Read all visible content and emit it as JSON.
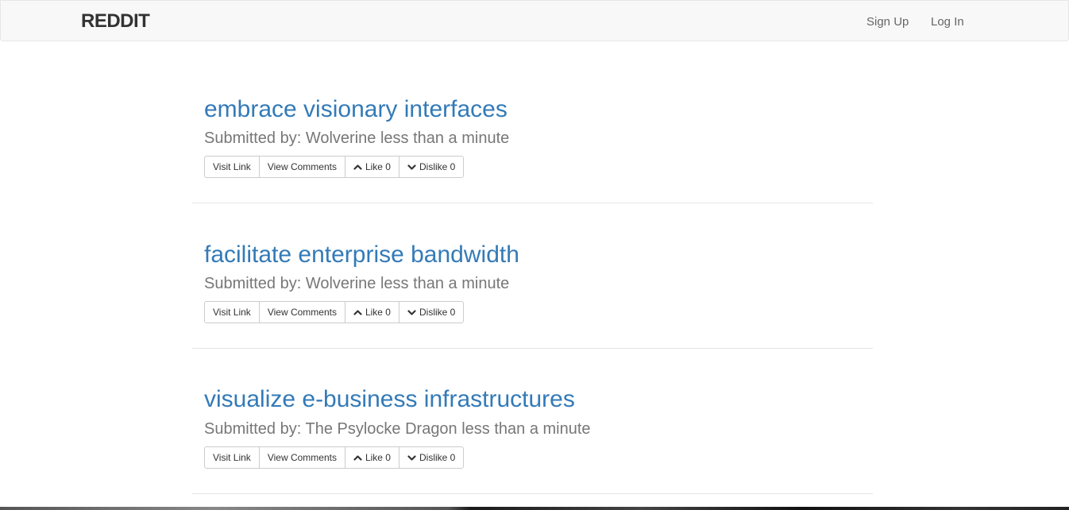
{
  "navbar": {
    "brand": "REDDIT",
    "links": [
      "Sign Up",
      "Log In"
    ]
  },
  "posts": [
    {
      "title": "embrace visionary interfaces",
      "meta": "Submitted by: Wolverine less than a minute",
      "buttons": {
        "visit": "Visit Link",
        "comments": "View Comments",
        "like": "Like 0",
        "dislike": "Dislike 0"
      }
    },
    {
      "title": "facilitate enterprise bandwidth",
      "meta": "Submitted by: Wolverine less than a minute",
      "buttons": {
        "visit": "Visit Link",
        "comments": "View Comments",
        "like": "Like 0",
        "dislike": "Dislike 0"
      }
    },
    {
      "title": "visualize e-business infrastructures",
      "meta": "Submitted by: The Psylocke Dragon less than a minute",
      "buttons": {
        "visit": "Visit Link",
        "comments": "View Comments",
        "like": "Like 0",
        "dislike": "Dislike 0"
      }
    }
  ],
  "icons": {
    "like": "chevron-up-icon",
    "dislike": "chevron-down-icon"
  },
  "colors": {
    "title_link": "#337ab7",
    "meta_text": "#777777",
    "navbar_bg": "#f8f8f8"
  }
}
